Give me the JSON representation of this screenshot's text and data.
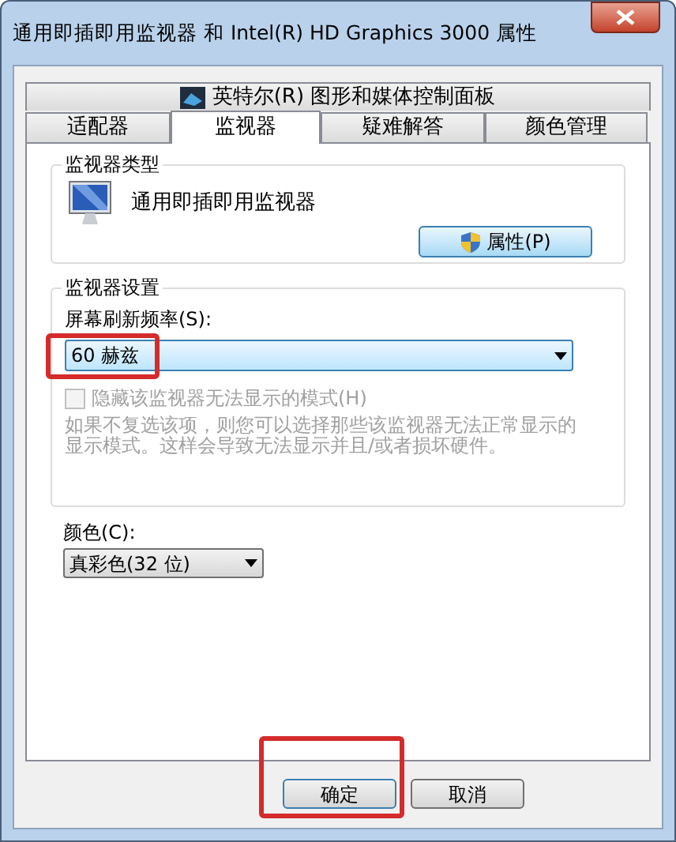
{
  "window": {
    "title": "通用即插即用监视器 和 Intel(R) HD Graphics 3000 属性"
  },
  "tabs_top": [
    {
      "label": "英特尔(R) 图形和媒体控制面板",
      "selected": false
    }
  ],
  "tabs": [
    {
      "label": "适配器",
      "selected": false
    },
    {
      "label": "监视器",
      "selected": true
    },
    {
      "label": "疑难解答",
      "selected": false
    },
    {
      "label": "颜色管理",
      "selected": false
    }
  ],
  "monitor_type": {
    "title": "监视器类型",
    "name": "通用即插即用监视器",
    "button": "属性(P)"
  },
  "monitor_settings": {
    "title": "监视器设置",
    "refresh_label": "屏幕刷新频率(S):",
    "refresh_value": "60 赫兹",
    "refresh_highlighted": true,
    "hide_modes": {
      "label": "隐藏该监视器无法显示的模式(H)",
      "checked": false,
      "disabled": true
    },
    "hint": "如果不复选该项，则您可以选择那些该监视器无法正常显示的显示模式。这样会导致无法显示并且/或者损坏硬件。"
  },
  "color": {
    "label": "颜色(C):",
    "value": "真彩色(32 位)"
  },
  "buttons": [
    {
      "label": "确定",
      "highlighted": true
    },
    {
      "label": "取消",
      "highlighted": false
    }
  ]
}
